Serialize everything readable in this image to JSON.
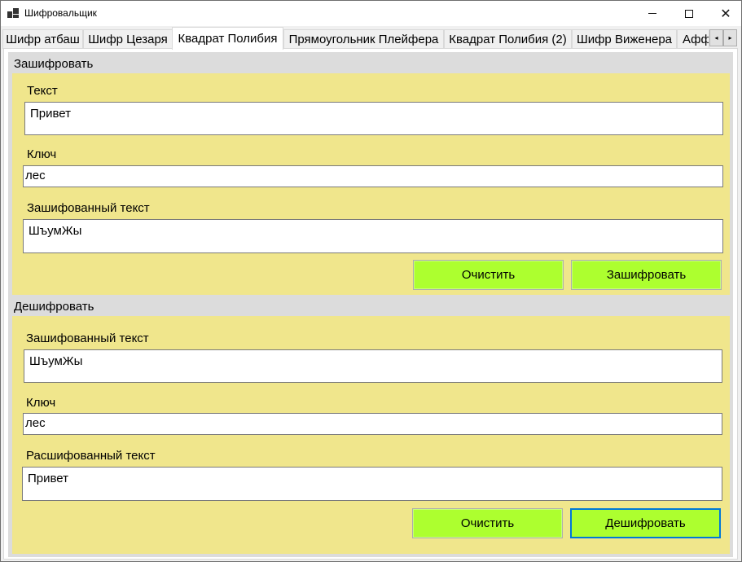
{
  "window": {
    "title": "Шифровальщик",
    "minimize": "minimize",
    "maximize": "maximize",
    "close_glyph": "✕"
  },
  "tabs": [
    {
      "label": "Шифр атбаш"
    },
    {
      "label": "Шифр Цезаря"
    },
    {
      "label": "Квадрат Полибия",
      "active": true
    },
    {
      "label": "Прямоугольник Плейфера"
    },
    {
      "label": "Квадрат Полибия (2)"
    },
    {
      "label": "Шифр Виженера"
    },
    {
      "label": "Афф"
    }
  ],
  "tab_scroll": {
    "left": "◂",
    "right": "▸"
  },
  "encrypt": {
    "group_title": "Зашифровать",
    "text_label": "Текст",
    "text_value": "Привет",
    "key_label": "Ключ",
    "key_value": "лес",
    "result_label": "Зашифованный текст",
    "result_value": "ШъумЖы",
    "clear_label": "Очистить",
    "action_label": "Зашифровать"
  },
  "decrypt": {
    "group_title": "Дешифровать",
    "text_label": "Зашифованный текст",
    "text_value": "ШъумЖы",
    "key_label": "Ключ",
    "key_value": "лес",
    "result_label": "Расшифованный текст",
    "result_value": "Привет",
    "clear_label": "Очистить",
    "action_label": "Дешифровать"
  },
  "colors": {
    "panel": "#f0e68c",
    "button": "#adff2f",
    "focus": "#0078d7"
  }
}
